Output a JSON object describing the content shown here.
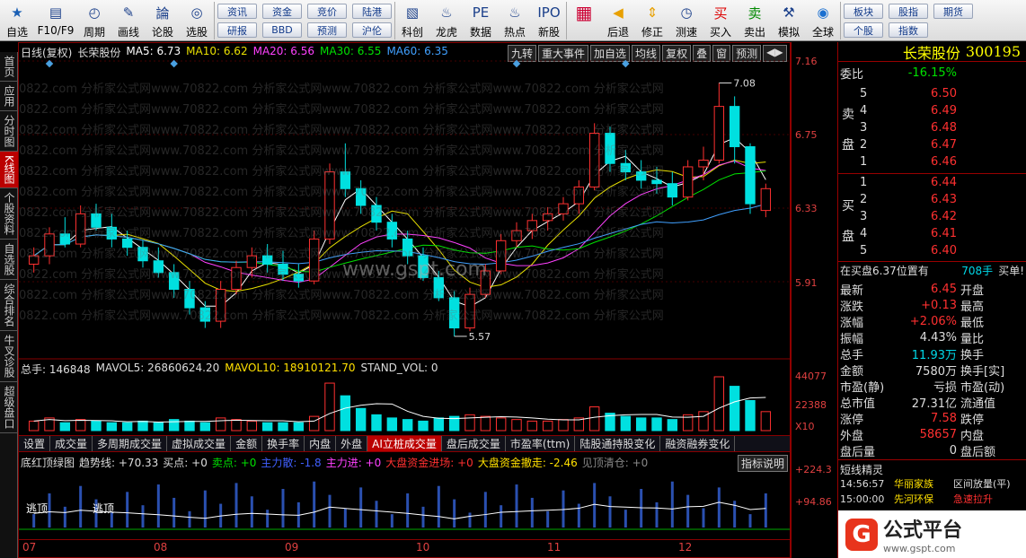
{
  "toolbar": {
    "items": [
      {
        "label": "自选",
        "icon": "star-icon"
      },
      {
        "label": "F10/F9",
        "icon": "report-icon"
      },
      {
        "label": "周期",
        "icon": "clock-icon"
      },
      {
        "label": "画线",
        "icon": "pencil-icon"
      },
      {
        "label": "论股",
        "icon": "discuss-icon"
      },
      {
        "label": "选股",
        "icon": "select-stock-icon"
      }
    ],
    "pills": [
      [
        "资讯",
        "研报"
      ],
      [
        "资金",
        "BBD"
      ],
      [
        "竞价",
        "预测"
      ],
      [
        "陆港",
        "沪伦"
      ]
    ],
    "items2": [
      {
        "label": "科创",
        "icon": "chart-icon"
      },
      {
        "label": "龙虎",
        "icon": "dragon-tiger-icon"
      },
      {
        "label": "数据",
        "icon": "pe-icon"
      },
      {
        "label": "热点",
        "icon": "flame-icon"
      },
      {
        "label": "新股",
        "icon": "ipo-icon"
      }
    ],
    "items3": [
      {
        "label": "后退",
        "icon": "back-arrow-icon"
      },
      {
        "label": "修正",
        "icon": "up-down-icon"
      },
      {
        "label": "测速",
        "icon": "speed-test-icon"
      },
      {
        "label": "买入",
        "icon": "buy-icon"
      },
      {
        "label": "卖出",
        "icon": "sell-icon"
      },
      {
        "label": "模拟",
        "icon": "simulate-icon"
      },
      {
        "label": "全球",
        "icon": "globe-icon"
      }
    ],
    "right_pills": [
      [
        "板块",
        "个股"
      ],
      [
        "股指",
        "指数"
      ],
      [
        "期货",
        ""
      ]
    ]
  },
  "left_tabs": [
    "首页",
    "应用",
    "分时图",
    "K线图",
    "个股资料",
    "自选股",
    "综合排名",
    "牛叉诊股",
    "超级盘口"
  ],
  "left_active": 3,
  "kline_header": {
    "period": "日线(复权)",
    "name": "长荣股份",
    "ma5": "MA5: 6.73",
    "ma10": "MA10: 6.62",
    "ma20": "MA20: 6.56",
    "ma30": "MA30: 6.55",
    "ma60": "MA60: 6.35"
  },
  "kline_buttons": [
    "九转",
    "重大事件",
    "加自选",
    "均线",
    "复权",
    "叠",
    "窗",
    "预测"
  ],
  "price_axis": [
    "7.16",
    "6.75",
    "6.33",
    "5.91"
  ],
  "high_label": "7.08",
  "low_label": "5.57",
  "vol_header": {
    "total": "总手: 146848",
    "mavol5": "MAVOL5: 26860624.20",
    "mavol10": "MAVOL10: 18910121.70",
    "std": "STAND_VOL: 0"
  },
  "vol_axis": [
    "44077",
    "22388",
    "X10"
  ],
  "bottom_tabs": [
    "设置",
    "成交量",
    "多周期成交量",
    "虚拟成交量",
    "金额",
    "换手率",
    "内盘",
    "外盘",
    "AI立桩成交量",
    "盘后成交量",
    "市盈率(ttm)",
    "陆股通持股变化",
    "融资融券变化"
  ],
  "bottom_active": 8,
  "ind_header": {
    "name": "底红顶绿图",
    "trend": "趋势线: +70.33",
    "buy": "买点: +0",
    "sell": "卖点: +0",
    "main_in": "主力散: -1.8",
    "main_go": "主力进: +0",
    "big_in": "大盘资金进场: +0",
    "big_out": "大盘资金撤走: -2.46",
    "warn": "见顶清仓: +0",
    "btn": "指标说明"
  },
  "ind_axis": [
    "+224.3",
    "+94.86"
  ],
  "ind_labels": [
    "逃顶",
    "逃顶"
  ],
  "months": [
    "07",
    "08",
    "09",
    "10",
    "11",
    "12"
  ],
  "watermarks": [
    "www.gspt.com",
    "0822.com 分析家公式网www.70822.com 分析家公式网www.70822.com 分析家公式网www.70822.com 分析家公式网"
  ],
  "quote": {
    "title": "长荣股份",
    "code": "300195",
    "weibi_label": "委比",
    "weibi": "-16.15%",
    "sell_label": [
      "卖",
      "盘"
    ],
    "buy_label": [
      "买",
      "盘"
    ],
    "asks": [
      [
        "5",
        "6.50"
      ],
      [
        "4",
        "6.49"
      ],
      [
        "3",
        "6.48"
      ],
      [
        "2",
        "6.47"
      ],
      [
        "1",
        "6.46"
      ]
    ],
    "bids": [
      [
        "1",
        "6.44"
      ],
      [
        "2",
        "6.43"
      ],
      [
        "3",
        "6.42"
      ],
      [
        "4",
        "6.41"
      ],
      [
        "5",
        "6.40"
      ]
    ],
    "buy_queue": "在买盘6.37位置有",
    "buy_queue_vol": "708手",
    "buy_tag": "买单!",
    "stats": [
      [
        "最新",
        "6.45",
        "开盘",
        ""
      ],
      [
        "涨跌",
        "+0.13",
        "最高",
        ""
      ],
      [
        "涨幅",
        "+2.06%",
        "最低",
        ""
      ],
      [
        "振幅",
        "4.43%",
        "量比",
        ""
      ],
      [
        "总手",
        "11.93万",
        "换手",
        ""
      ],
      [
        "金额",
        "7580万",
        "换手[实]",
        ""
      ],
      [
        "市盈(静)",
        "亏损",
        "市盈(动)",
        ""
      ],
      [
        "总市值",
        "27.31亿",
        "流通值",
        ""
      ],
      [
        "涨停",
        "7.58",
        "跌停",
        ""
      ],
      [
        "外盘",
        "58657",
        "内盘",
        ""
      ],
      [
        "盘后量",
        "0",
        "盘后额",
        ""
      ]
    ],
    "short_title": "短线精灵",
    "short_rows": [
      [
        "14:56:57",
        "华丽家族",
        "区间放量(平)"
      ],
      [
        "15:00:00",
        "先河环保",
        "急速拉升"
      ]
    ],
    "logo_text": "公式平台",
    "logo_url": "www.gspt.com"
  },
  "colors": {
    "up": "#ff3030",
    "down": "#00e0e0",
    "ma5": "#ffffff",
    "ma10": "#e8e000",
    "ma20": "#ff40ff",
    "ma30": "#00e000",
    "ma60": "#40a0ff"
  },
  "chart_data": {
    "type": "candlestick",
    "candles": [
      [
        6.0,
        6.1,
        5.95,
        6.05
      ],
      [
        6.05,
        6.22,
        6.0,
        6.18
      ],
      [
        6.18,
        6.28,
        6.1,
        6.12
      ],
      [
        6.12,
        6.35,
        6.1,
        6.3
      ],
      [
        6.3,
        6.36,
        6.2,
        6.22
      ],
      [
        6.22,
        6.3,
        6.1,
        6.15
      ],
      [
        6.15,
        6.2,
        6.05,
        6.1
      ],
      [
        6.1,
        6.14,
        5.98,
        6.02
      ],
      [
        6.02,
        6.1,
        5.92,
        5.95
      ],
      [
        5.95,
        6.0,
        5.8,
        5.85
      ],
      [
        5.85,
        5.9,
        5.7,
        5.74
      ],
      [
        5.74,
        5.78,
        5.62,
        5.66
      ],
      [
        5.66,
        5.9,
        5.62,
        5.85
      ],
      [
        5.85,
        6.02,
        5.82,
        5.98
      ],
      [
        5.98,
        6.1,
        5.92,
        6.05
      ],
      [
        6.05,
        6.12,
        5.95,
        6.0
      ],
      [
        6.0,
        6.08,
        5.9,
        5.94
      ],
      [
        5.94,
        6.0,
        5.86,
        5.9
      ],
      [
        5.9,
        6.2,
        5.88,
        6.15
      ],
      [
        6.15,
        6.6,
        6.12,
        6.55
      ],
      [
        6.55,
        6.72,
        6.4,
        6.45
      ],
      [
        6.45,
        6.5,
        6.3,
        6.35
      ],
      [
        6.35,
        6.4,
        6.2,
        6.25
      ],
      [
        6.25,
        6.3,
        6.1,
        6.15
      ],
      [
        6.15,
        6.2,
        6.0,
        6.05
      ],
      [
        6.05,
        6.1,
        5.9,
        5.92
      ],
      [
        5.92,
        5.96,
        5.78,
        5.8
      ],
      [
        5.8,
        5.84,
        5.57,
        5.62
      ],
      [
        5.62,
        5.86,
        5.6,
        5.82
      ],
      [
        5.82,
        6.0,
        5.8,
        5.96
      ],
      [
        5.96,
        6.18,
        5.94,
        6.14
      ],
      [
        6.14,
        6.25,
        6.1,
        6.2
      ],
      [
        6.2,
        6.3,
        6.15,
        6.26
      ],
      [
        6.26,
        6.34,
        6.2,
        6.3
      ],
      [
        6.3,
        6.4,
        6.26,
        6.36
      ],
      [
        6.36,
        6.5,
        6.3,
        6.46
      ],
      [
        6.46,
        6.84,
        6.44,
        6.78
      ],
      [
        6.78,
        6.82,
        6.55,
        6.6
      ],
      [
        6.6,
        6.68,
        6.5,
        6.55
      ],
      [
        6.55,
        6.62,
        6.45,
        6.5
      ],
      [
        6.5,
        6.58,
        6.42,
        6.48
      ],
      [
        6.48,
        6.55,
        6.35,
        6.4
      ],
      [
        6.4,
        6.62,
        6.38,
        6.58
      ],
      [
        6.58,
        6.7,
        6.5,
        6.62
      ],
      [
        6.62,
        7.08,
        6.6,
        6.94
      ],
      [
        6.94,
        7.0,
        6.6,
        6.7
      ],
      [
        6.7,
        6.72,
        6.3,
        6.36
      ],
      [
        6.32,
        6.48,
        6.28,
        6.45
      ]
    ],
    "volume": [
      6,
      8,
      5,
      7,
      6,
      5,
      5,
      6,
      5,
      7,
      6,
      5,
      8,
      7,
      6,
      5,
      5,
      5,
      9,
      30,
      22,
      14,
      10,
      8,
      7,
      6,
      8,
      9,
      10,
      9,
      8,
      7,
      6,
      6,
      7,
      8,
      15,
      11,
      9,
      8,
      8,
      7,
      10,
      12,
      34,
      28,
      19,
      12
    ],
    "price_range": [
      5.5,
      7.2
    ],
    "volume_max": 44077
  }
}
